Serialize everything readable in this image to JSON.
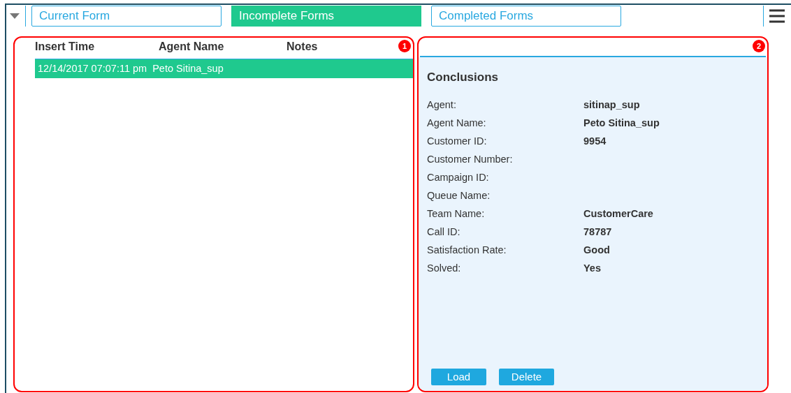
{
  "tabs": [
    {
      "label": "Current Form",
      "selected": false
    },
    {
      "label": "Incomplete Forms",
      "selected": true
    },
    {
      "label": "Completed Forms",
      "selected": false
    }
  ],
  "list_panel": {
    "callout": "1",
    "columns": [
      "Insert Time",
      "Agent Name",
      "Notes"
    ],
    "rows": [
      {
        "insert_time": "12/14/2017 07:07:11 pm",
        "agent_name": "Peto Sitina_sup",
        "selected": true
      }
    ]
  },
  "detail_panel": {
    "callout": "2",
    "title": "Conclusions",
    "fields": [
      {
        "label": "Agent:",
        "value": "sitinap_sup"
      },
      {
        "label": "Agent Name:",
        "value": "Peto Sitina_sup"
      },
      {
        "label": "Customer ID:",
        "value": "9954"
      },
      {
        "label": "Customer Number:"
      },
      {
        "label": "Campaign ID:"
      },
      {
        "label": "Queue Name:"
      },
      {
        "label": "Team Name:",
        "value": "CustomerCare"
      },
      {
        "label": "Call ID:",
        "value": "78787"
      },
      {
        "label": "Satisfaction Rate:",
        "value": "Good"
      },
      {
        "label": "Solved:",
        "value": "Yes"
      }
    ],
    "buttons": [
      "Load",
      "Delete"
    ]
  }
}
